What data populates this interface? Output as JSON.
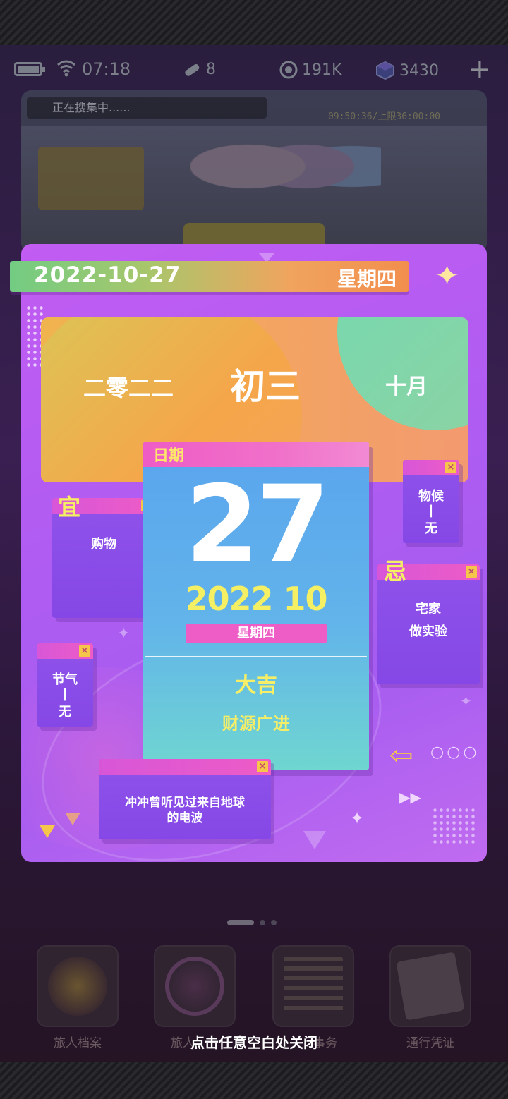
{
  "status_bar": {
    "time": "07:18",
    "stat_1": "8",
    "stat_2": "191K",
    "stat_3": "3430",
    "add": "+"
  },
  "background_card": {
    "searching_text": "正在搜集中......",
    "timer_text": "09:50:36/上限36:00:00"
  },
  "popup": {
    "gregorian_date": "2022-10-27",
    "weekday": "星期四",
    "lunar": {
      "year": "二零二二",
      "day": "初三",
      "month": "十月"
    },
    "date_card": {
      "header": "日期",
      "day": "27",
      "year_month": "2022 10",
      "weekday": "星期四",
      "fortune": "大吉",
      "fortune_detail": "财源广进"
    },
    "yi": {
      "tag": "宜",
      "text": "购物"
    },
    "ji": {
      "tag": "忌",
      "line1": "宅家",
      "line2": "做实验"
    },
    "phenology": {
      "line1": "物候",
      "line2": "|",
      "line3": "无"
    },
    "solar_term": {
      "line1": "节气",
      "line2": "|",
      "line3": "无"
    },
    "message": {
      "line1": "冲冲曾听见过来自地球",
      "line2": "的电波"
    },
    "close_x": "×"
  },
  "bottom_nav": {
    "items": [
      {
        "label": "旅人档案"
      },
      {
        "label": "旅人"
      },
      {
        "label": "事务"
      },
      {
        "label": "通行凭证"
      }
    ]
  },
  "close_hint": "点击任意空白处关闭",
  "colors": {
    "accent_pink": "#ee5cc6",
    "accent_yellow": "#f5ef64",
    "popup_purple": "#b05cf2",
    "card_blue": "#5aa4ee"
  }
}
